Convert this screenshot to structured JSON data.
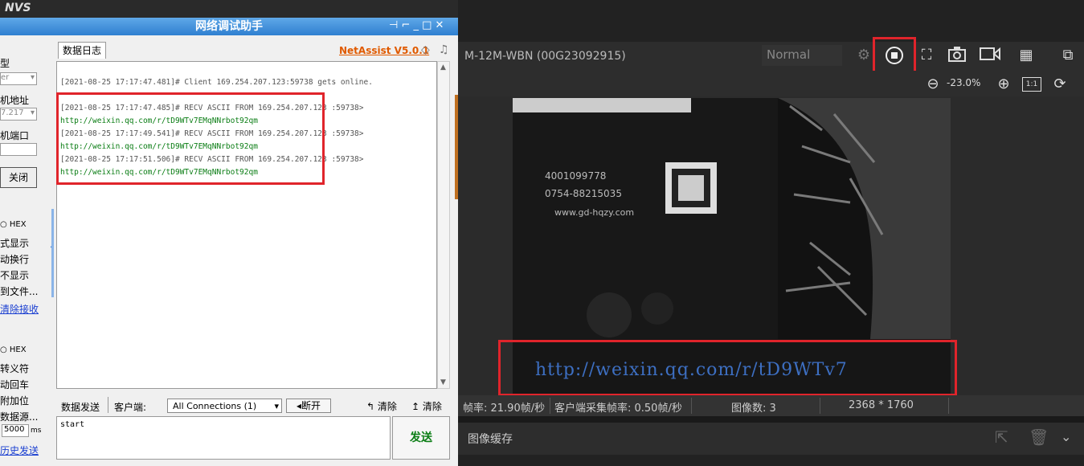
{
  "logo": "NVS",
  "assist": {
    "title": "网络调试助手",
    "log_tab": "数据日志",
    "brand": "NetAssist V5.0.1",
    "side_labels": [
      "型",
      "er",
      "机地址",
      "7.217",
      "机端口",
      "关闭",
      "HEX",
      "式显示",
      "动换行",
      "不显示",
      "到文件...",
      "清除接收",
      "HEX",
      "转义符",
      "动回车",
      "附加位",
      "数据源...",
      "5000",
      "ms",
      "历史发送"
    ],
    "log_lines": [
      {
        "text": "[2021-08-25 17:17:47.481]# Client 169.254.207.123:59738 gets online.",
        "kind": "meta"
      },
      {
        "text": "[2021-08-25 17:17:47.485]# RECV ASCII FROM 169.254.207.123 :59738>",
        "kind": "meta"
      },
      {
        "text": "http://weixin.qq.com/r/tD9WTv7EMqNNrbot92qm",
        "kind": "payload"
      },
      {
        "text": "[2021-08-25 17:17:49.541]# RECV ASCII FROM 169.254.207.123 :59738>",
        "kind": "meta"
      },
      {
        "text": "http://weixin.qq.com/r/tD9WTv7EMqNNrbot92qm",
        "kind": "payload"
      },
      {
        "text": "[2021-08-25 17:17:51.506]# RECV ASCII FROM 169.254.207.123 :59738>",
        "kind": "meta"
      },
      {
        "text": "http://weixin.qq.com/r/tD9WTv7EMqNNrbot92qm",
        "kind": "payload"
      }
    ],
    "send_tab": "数据发送",
    "client_label": "客户端:",
    "connections": "All Connections (1)",
    "disconnect": "断开",
    "clear1": "清除",
    "clear2": "清除",
    "send_text": "start",
    "send_button": "发送"
  },
  "camera": {
    "device": "M-12M-WBN (00G23092915)",
    "mode": "Normal",
    "zoom": "-23.0%",
    "overlay_url": "http://weixin.qq.com/r/tD9WTv7",
    "status": {
      "fps": "帧率: 21.90帧/秒",
      "client_fps": "客户端采集帧率: 0.50帧/秒",
      "image_count": "图像数: 3",
      "resolution": "2368 * 1760"
    },
    "cache_label": "图像缓存",
    "image_text": [
      "4001099778",
      "0754-88215035",
      "www.gd-hqzy.com"
    ]
  },
  "colors": {
    "red_box": "#e0242b",
    "payload": "#0a7d14",
    "brand": "#e05a00"
  }
}
